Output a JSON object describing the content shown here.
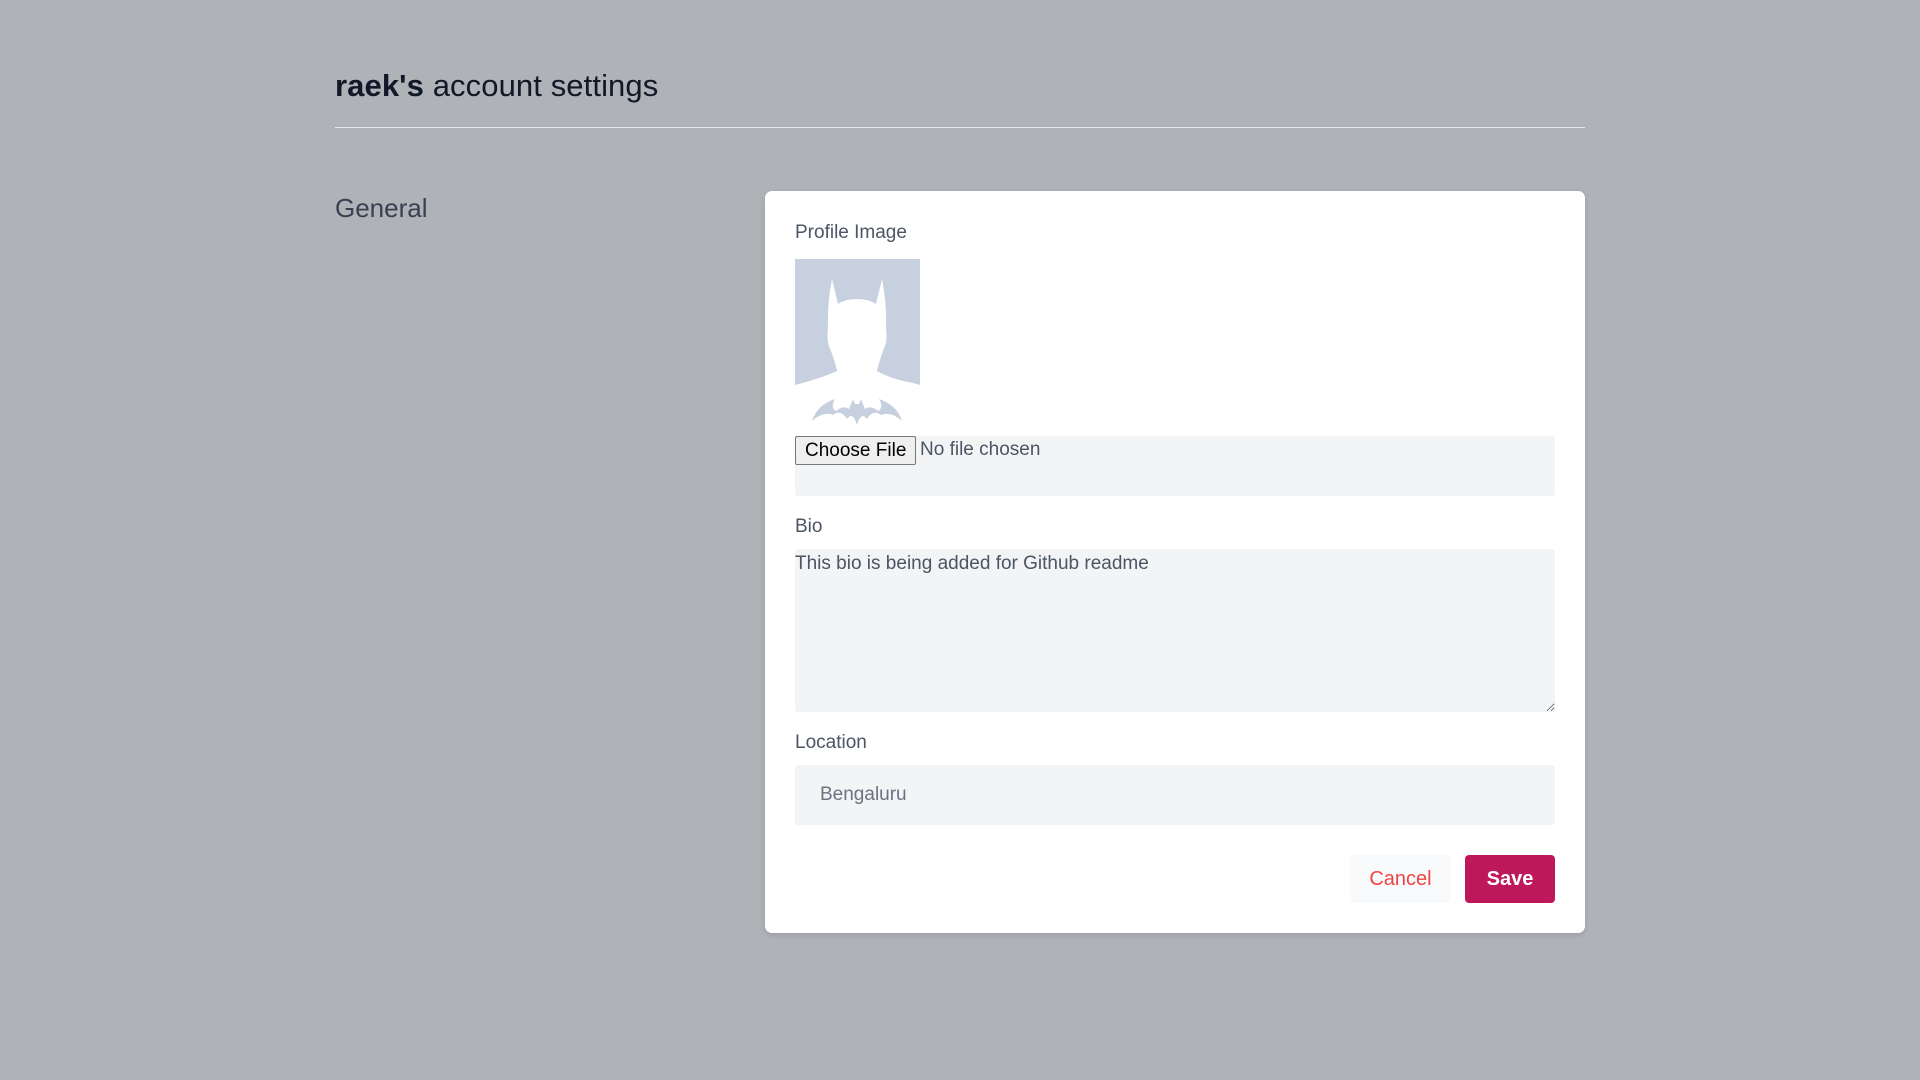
{
  "header": {
    "username": "raek's",
    "title_suffix": " account settings"
  },
  "sidebar": {
    "section_title": "General"
  },
  "form": {
    "profile_image_label": "Profile Image",
    "avatar_icon": "batman-silhouette-icon",
    "file_button_label": "Choose File",
    "file_status": "No file chosen",
    "bio_label": "Bio",
    "bio_value": "This bio is being added for Github readme",
    "location_label": "Location",
    "location_placeholder": "Bengaluru",
    "location_value": "",
    "cancel_label": "Cancel",
    "save_label": "Save"
  },
  "colors": {
    "page_background": "#afb2b7",
    "card_background": "#ffffff",
    "field_background": "#f3f4f6",
    "save_button": "#be185d",
    "cancel_text": "#ef4444",
    "avatar_background": "#c7d0df"
  }
}
